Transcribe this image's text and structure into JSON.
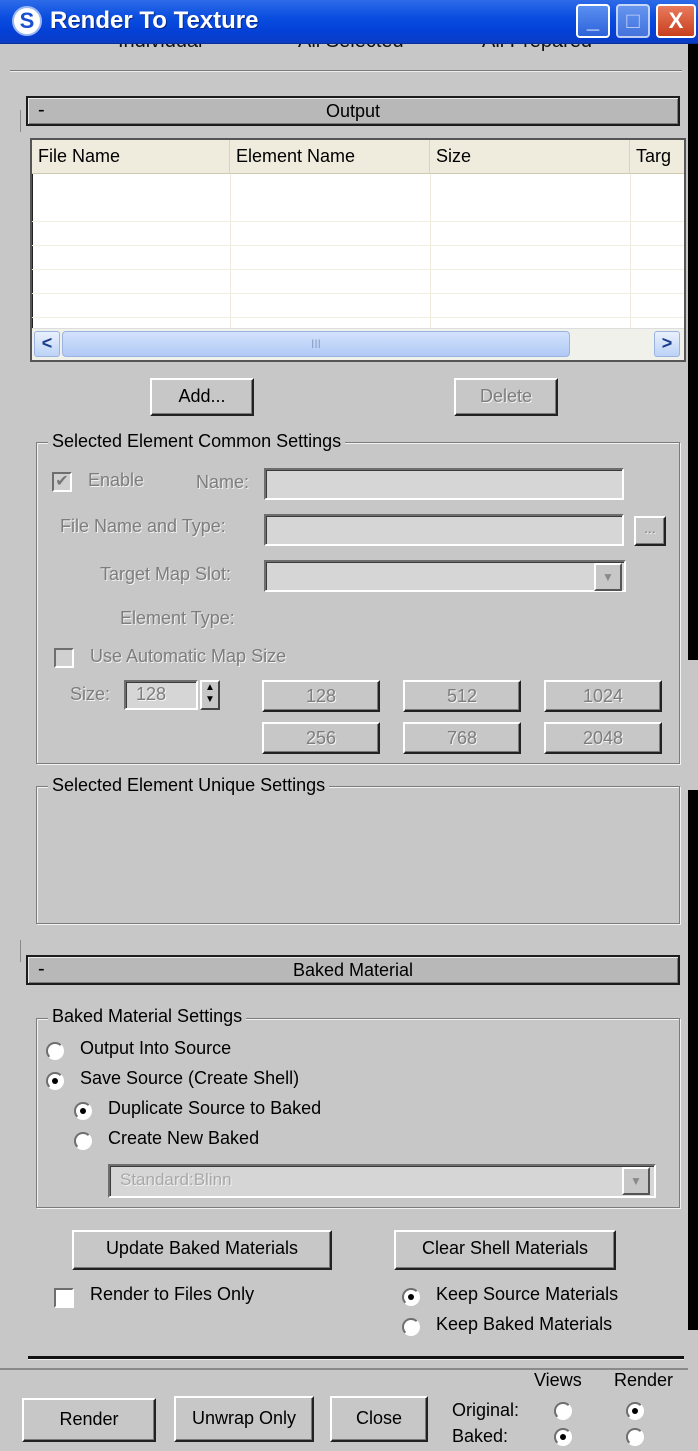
{
  "window": {
    "title": "Render To Texture",
    "icon": "3ds-logo-icon",
    "min": "_",
    "max": "□",
    "close": "X"
  },
  "top_radios": {
    "individual": "Individual",
    "all_selected": "All Selected",
    "all_prepared": "All Prepared"
  },
  "output": {
    "rollout_minus": "-",
    "rollout_title": "Output",
    "columns": [
      "File Name",
      "Element Name",
      "Size",
      "Targ"
    ],
    "scroll_left": "<",
    "scroll_right": ">",
    "scroll_grip": "III",
    "add_label": "Add...",
    "delete_label": "Delete"
  },
  "common": {
    "title": "Selected Element Common Settings",
    "enable_label": "Enable",
    "enable_mark": "✔",
    "name_label": "Name:",
    "file_name_label": "File Name and Type:",
    "browse_label": "...",
    "target_slot_label": "Target Map Slot:",
    "element_type_label": "Element Type:",
    "auto_size_label": "Use Automatic Map Size",
    "size_label": "Size:",
    "size_value": "128",
    "size_buttons": [
      "128",
      "512",
      "1024",
      "256",
      "768",
      "2048"
    ]
  },
  "unique": {
    "title": "Selected Element Unique Settings"
  },
  "baked": {
    "rollout_minus": "-",
    "rollout_title": "Baked Material",
    "settings_title": "Baked Material Settings",
    "output_into_source": "Output Into Source",
    "save_source": "Save Source (Create Shell)",
    "duplicate_source": "Duplicate Source to Baked",
    "create_new": "Create New Baked",
    "material_type": "Standard:Blinn",
    "update_label": "Update Baked Materials",
    "clear_label": "Clear Shell Materials",
    "render_files_only": "Render to Files Only",
    "keep_source": "Keep Source Materials",
    "keep_baked": "Keep Baked Materials"
  },
  "footer": {
    "render": "Render",
    "unwrap": "Unwrap Only",
    "close": "Close",
    "views_header": "Views",
    "render_header": "Render",
    "original_label": "Original:",
    "baked_label": "Baked:"
  }
}
